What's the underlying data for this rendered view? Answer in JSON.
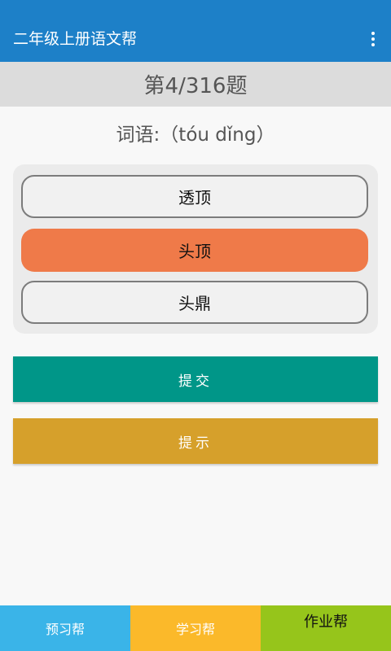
{
  "appbar": {
    "title": "二年级上册语文帮",
    "menu_icon": "more-vert-icon"
  },
  "question": {
    "number_text": "第4/316题",
    "prompt": "词语:（tóu dǐng）"
  },
  "options": [
    {
      "label": "透顶",
      "selected": false
    },
    {
      "label": "头顶",
      "selected": true
    },
    {
      "label": "头鼎",
      "selected": false
    }
  ],
  "actions": {
    "submit_label": "提交",
    "hint_label": "提示"
  },
  "tabs": [
    {
      "label": "预习帮",
      "color": "#3ab4e8"
    },
    {
      "label": "学习帮",
      "color": "#fbb92a"
    },
    {
      "label": "作业帮",
      "color": "#96c51b"
    }
  ],
  "colors": {
    "appbar": "#1d80c8",
    "selected_option": "#ef7a49",
    "submit": "#009688",
    "hint": "#d6a02b"
  }
}
